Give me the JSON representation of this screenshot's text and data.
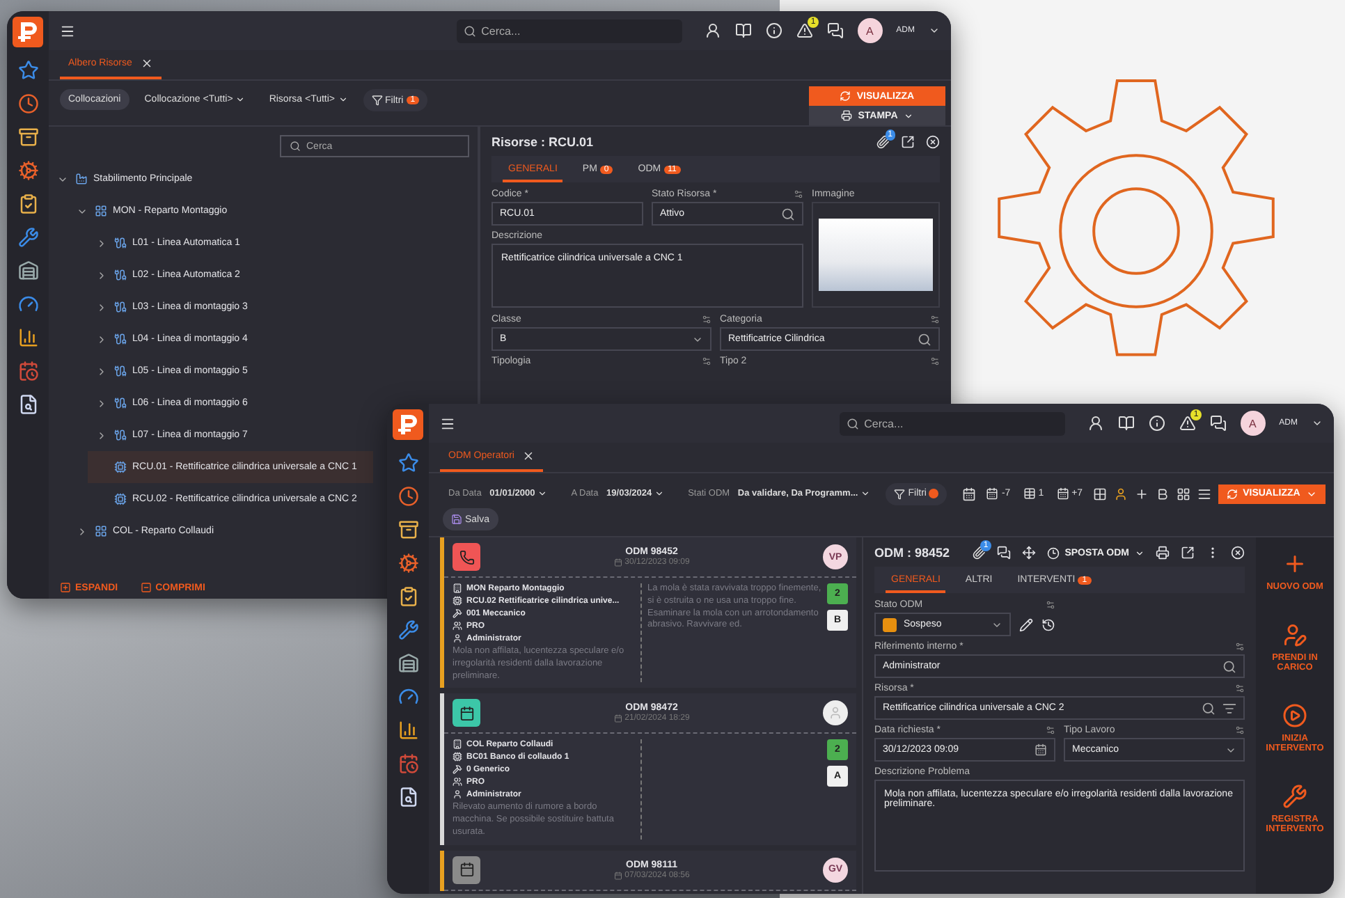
{
  "back_window": {
    "topbar": {
      "search_placeholder": "Cerca...",
      "alert_count": "1",
      "user_initial": "A",
      "user": "ADM"
    },
    "tab": {
      "label": "Albero Risorse"
    },
    "filters": [
      {
        "kind": "chip",
        "label": "Collocazioni"
      },
      {
        "kind": "dropdown",
        "label": "Collocazione <Tutti>"
      },
      {
        "kind": "dropdown",
        "label": "Risorsa <Tutti>"
      },
      {
        "kind": "filter",
        "label": "Filtri",
        "badge": "1"
      }
    ],
    "primary_button": "VISUALIZZA",
    "print_button": "STAMPA",
    "tree": {
      "search_placeholder": "Cerca",
      "items": [
        {
          "kind": "plant",
          "label": "Stabilimento Principale",
          "expanded": true,
          "selected": false,
          "children": [
            {
              "kind": "department",
              "label": "MON - Reparto Montaggio",
              "expanded": true,
              "selected": false,
              "children": [
                {
                  "kind": "line",
                  "label": "L01 - Linea Automatica 1",
                  "expanded": false,
                  "selected": false
                },
                {
                  "kind": "line",
                  "label": "L02 - Linea Automatica 2",
                  "expanded": false,
                  "selected": false
                },
                {
                  "kind": "line",
                  "label": "L03 - Linea di montaggio 3",
                  "expanded": false,
                  "selected": false
                },
                {
                  "kind": "line",
                  "label": "L04 - Linea di montaggio 4",
                  "expanded": false,
                  "selected": false
                },
                {
                  "kind": "line",
                  "label": "L05 - Linea di montaggio 5",
                  "expanded": false,
                  "selected": false
                },
                {
                  "kind": "line",
                  "label": "L06 - Linea di montaggio 6",
                  "expanded": false,
                  "selected": false
                },
                {
                  "kind": "line",
                  "label": "L07 - Linea di montaggio 7",
                  "expanded": false,
                  "selected": false
                },
                {
                  "kind": "machine",
                  "label": "RCU.01 - Rettificatrice cilindrica universale a CNC 1",
                  "selected": true
                },
                {
                  "kind": "machine",
                  "label": "RCU.02 - Rettificatrice cilindrica universale a CNC 2",
                  "selected": false
                }
              ]
            },
            {
              "kind": "department",
              "label": "COL - Reparto Collaudi",
              "expanded": false,
              "selected": false
            }
          ]
        }
      ]
    },
    "tree_actions": [
      {
        "kind": "expand",
        "label": "ESPANDI"
      },
      {
        "kind": "collapse",
        "label": "COMPRIMI"
      }
    ],
    "detail": {
      "title": "Risorse : RCU.01",
      "attachment_count": "1",
      "tabs": [
        {
          "label": "GENERALI",
          "selected": true
        },
        {
          "label": "PM",
          "badge": "0",
          "selected": false
        },
        {
          "label": "ODM",
          "badge": "11",
          "selected": false
        }
      ],
      "fields": [
        {
          "kind": "text",
          "label": "Codice *",
          "value": "RCU.01"
        },
        {
          "kind": "lookup",
          "label": "Stato Risorsa *",
          "value": "Attivo"
        },
        {
          "kind": "textarea",
          "label": "Descrizione",
          "value": "Rettificatrice cilindrica universale a CNC 1"
        },
        {
          "kind": "select",
          "label": "Classe",
          "value": "B"
        },
        {
          "kind": "lookup",
          "label": "Categoria",
          "value": "Rettificatrice Cilindrica"
        },
        {
          "kind": "label",
          "label": "Tipologia"
        },
        {
          "kind": "label",
          "label": "Tipo 2"
        }
      ],
      "image_label": "Immagine"
    }
  },
  "front_window": {
    "topbar": {
      "search_placeholder": "Cerca...",
      "alert_count": "1",
      "user_initial": "A",
      "user": "ADM"
    },
    "tab": {
      "label": "ODM Operatori"
    },
    "filters": [
      {
        "label": "Da Data",
        "value": "01/01/2000"
      },
      {
        "label": "A Data",
        "value": "19/03/2024"
      },
      {
        "label": "Stati ODM",
        "value": "Da validare, Da Programm..."
      }
    ],
    "filter_button": "Filtri",
    "day_buttons": [
      {
        "kind": "week",
        "label": "-7"
      },
      {
        "kind": "day",
        "label": "1"
      },
      {
        "kind": "week",
        "label": "+7"
      }
    ],
    "primary_button": "VISUALIZZA",
    "save_button": "Salva",
    "cards": [
      {
        "title": "ODM 98452",
        "date": "30/12/2023 09:09",
        "kind": "phone",
        "color": "#e8a020",
        "avatar": "VP",
        "lines": [
          {
            "kind": "department",
            "text": "MON Reparto Montaggio"
          },
          {
            "kind": "resource",
            "text": "RCU.02 Rettificatrice cilindrica unive..."
          },
          {
            "kind": "work",
            "text": "001 Meccanico"
          },
          {
            "kind": "team",
            "text": "PRO"
          },
          {
            "kind": "user",
            "text": "Administrator"
          }
        ],
        "description": "Mola non affilata, lucentezza speculare e/o irregolarità residenti dalla lavorazione preliminare.",
        "note": "La mola è stata ravvivata troppo finemente, si è ostruita o ne usa una troppo fine. Esaminare la mola con un arrotondamento abrasivo. Ravvivare ed.",
        "badges": [
          {
            "text": "2",
            "kind": "green"
          },
          {
            "text": "B",
            "kind": "white"
          }
        ]
      },
      {
        "title": "ODM 98472",
        "date": "21/02/2024 18:29",
        "kind": "calendar",
        "color": "#d8d8d8",
        "lines": [
          {
            "kind": "department",
            "text": "COL Reparto Collaudi"
          },
          {
            "kind": "resource",
            "text": "BC01 Banco di collaudo 1"
          },
          {
            "kind": "work",
            "text": "0 Generico"
          },
          {
            "kind": "team",
            "text": "PRO"
          },
          {
            "kind": "user",
            "text": "Administrator"
          }
        ],
        "description": "Rilevato aumento di rumore a bordo macchina. Se possibile sostituire battuta usurata.",
        "badges": [
          {
            "text": "2",
            "kind": "green"
          },
          {
            "text": "A",
            "kind": "white"
          }
        ]
      },
      {
        "title": "ODM 98111",
        "date": "07/03/2024 08:56",
        "kind": "archive",
        "color": "#e8a020",
        "avatar": "GV"
      }
    ],
    "detail": {
      "title": "ODM : 98452",
      "attachment_count": "1",
      "move_button": "SPOSTA ODM",
      "tabs": [
        {
          "label": "GENERALI",
          "selected": true
        },
        {
          "label": "ALTRI",
          "selected": false
        },
        {
          "label": "INTERVENTI",
          "badge": "1",
          "selected": false
        }
      ],
      "fields": [
        {
          "kind": "status",
          "label": "Stato ODM",
          "value": "Sospeso",
          "color": "#e8900f"
        },
        {
          "kind": "lookup",
          "label": "Riferimento interno *",
          "value": "Administrator"
        },
        {
          "kind": "lookup-list",
          "label": "Risorsa *",
          "value": "Rettificatrice cilindrica universale a CNC 2"
        },
        {
          "kind": "date",
          "label": "Data richiesta *",
          "value": "30/12/2023 09:09"
        },
        {
          "kind": "select",
          "label": "Tipo Lavoro",
          "value": "Meccanico"
        },
        {
          "kind": "textarea",
          "label": "Descrizione Problema",
          "value": "Mola non affilata, lucentezza speculare e/o irregolarità residenti dalla lavorazione preliminare."
        }
      ]
    },
    "actions": [
      {
        "kind": "new",
        "label": "NUOVO ODM"
      },
      {
        "kind": "take",
        "label": "PRENDI IN CARICO"
      },
      {
        "kind": "start",
        "label": "INIZIA INTERVENTO"
      },
      {
        "kind": "register",
        "label": "REGISTRA INTERVENTO"
      }
    ]
  }
}
